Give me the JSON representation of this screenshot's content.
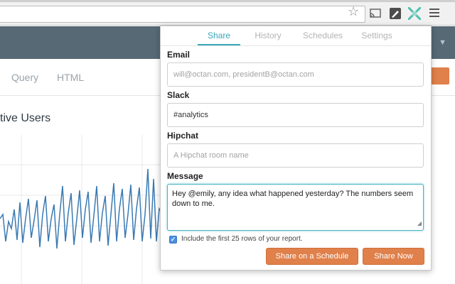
{
  "browser": {
    "icons": [
      "star-icon",
      "cast-icon",
      "pen-icon",
      "extension-icon",
      "menu-icon"
    ]
  },
  "app": {
    "nav": {
      "query": "Query",
      "html": "HTML"
    },
    "chart_title": "tive Users"
  },
  "popup": {
    "tabs": [
      "Share",
      "History",
      "Schedules",
      "Settings"
    ],
    "active_tab": "Share",
    "email": {
      "label": "Email",
      "placeholder": "will@octan.com, presidentB@octan.com",
      "value": ""
    },
    "slack": {
      "label": "Slack",
      "value": "#analytics"
    },
    "hipchat": {
      "label": "Hipchat",
      "placeholder": "A Hipchat room name",
      "value": ""
    },
    "message": {
      "label": "Message",
      "value": "Hey @emily, any idea what happened yesterday? The numbers seem down to me."
    },
    "include_rows": {
      "checked": true,
      "label": "Include the first 25 rows of your report."
    },
    "buttons": {
      "schedule": "Share on a Schedule",
      "now": "Share Now"
    }
  },
  "colors": {
    "accent": "#3aa6b9",
    "button": "#e0804a",
    "header": "#566975",
    "series": "#3a7ab3"
  }
}
